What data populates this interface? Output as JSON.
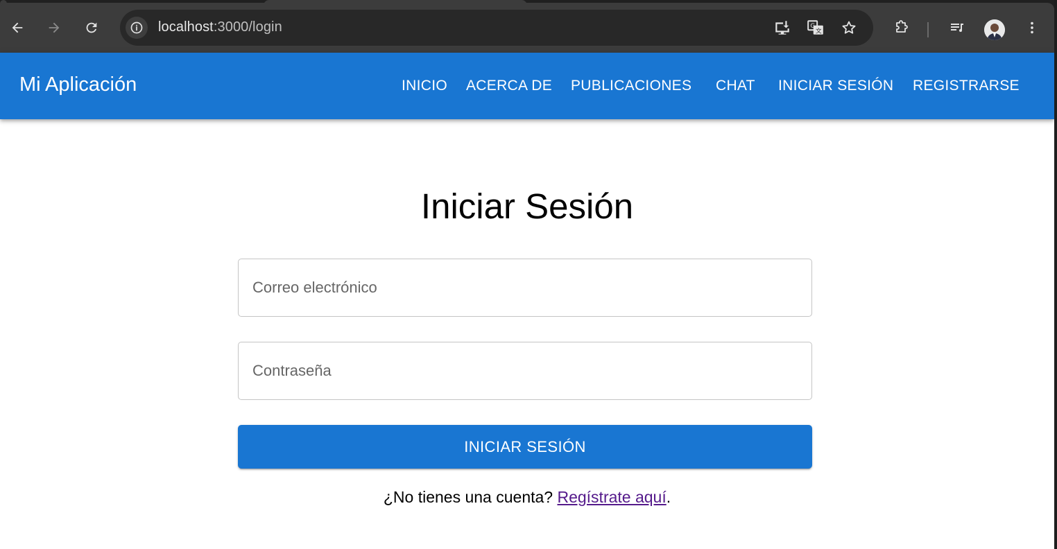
{
  "browser": {
    "url_host": "localhost",
    "url_path": ":3000/login",
    "icons": [
      "back-icon",
      "forward-icon",
      "reload-icon",
      "site-info-icon",
      "install-app-icon",
      "translate-icon",
      "bookmark-star-icon",
      "extensions-icon",
      "media-control-icon",
      "profile-avatar",
      "more-menu-icon"
    ]
  },
  "appbar": {
    "brand": "Mi Aplicación",
    "nav": [
      "INICIO",
      "ACERCA DE",
      "PUBLICACIONES",
      "CHAT",
      "INICIAR SESIÓN",
      "REGISTRARSE"
    ],
    "color": "#1976d2"
  },
  "login": {
    "title": "Iniciar Sesión",
    "email_placeholder": "Correo electrónico",
    "password_placeholder": "Contraseña",
    "submit_label": "INICIAR SESIÓN",
    "signup_prompt": "¿No tienes una cuenta? ",
    "signup_link": "Regístrate aquí",
    "signup_suffix": "."
  }
}
